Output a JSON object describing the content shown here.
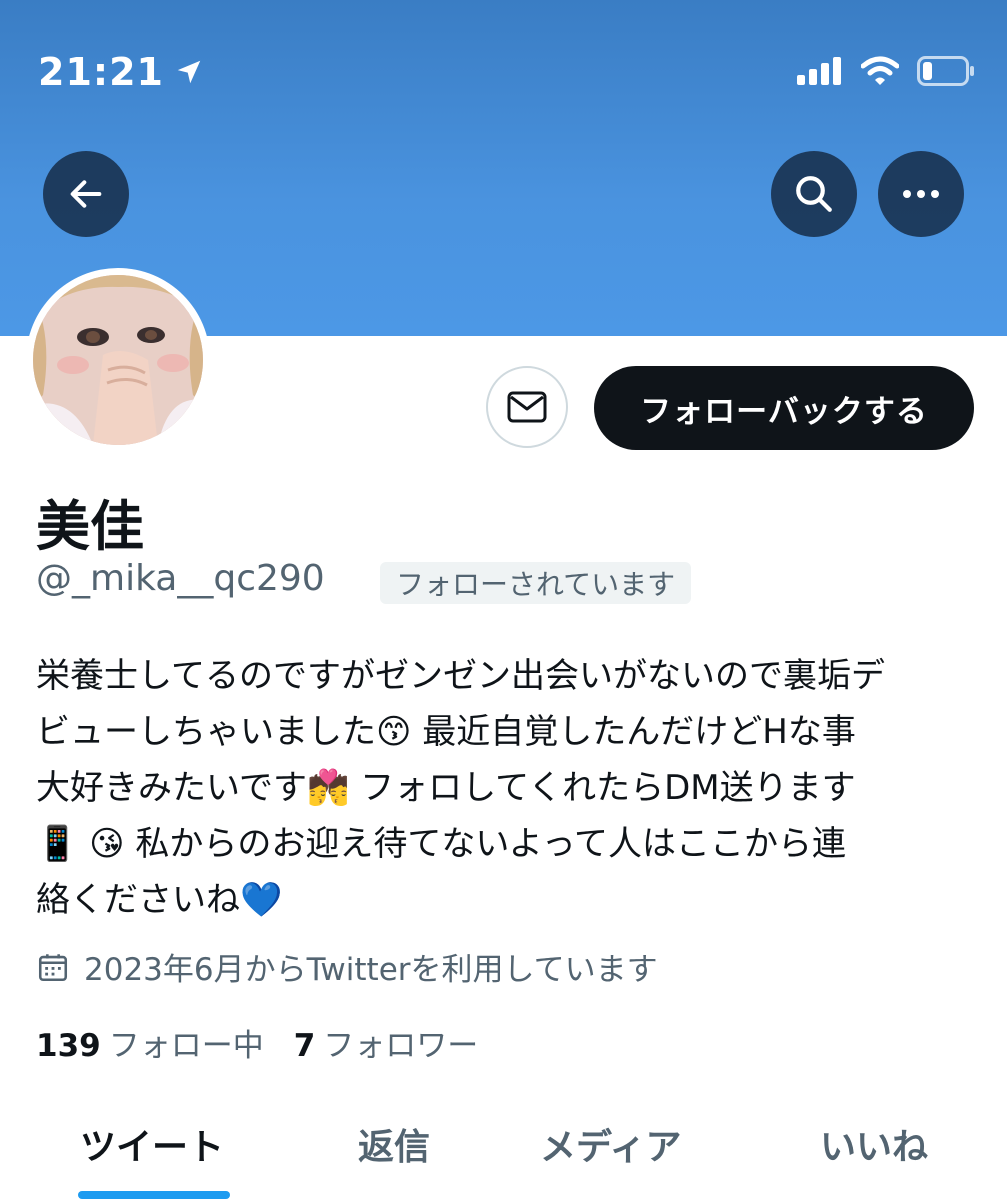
{
  "status_bar": {
    "time": "21:21"
  },
  "profile": {
    "name": "美佳",
    "handle": "@_mika__qc290",
    "follows_you": "フォローされています",
    "follow_back_label": "フォローバックする",
    "bio_lines": [
      "栄養士してるのですがゼンゼン出会いがないので裏垢デ",
      "ビューしちゃいました😙 最近自覚したんだけどHな事",
      "大好きみたいです💏 フォロしてくれたらDM送ります",
      "📱 😘 私からのお迎え待てないよって人はここから連",
      "絡くださいね💙"
    ],
    "joined": "2023年6月からTwitterを利用しています",
    "following_count": "139",
    "following_label": "フォロー中",
    "followers_count": "7",
    "followers_label": "フォロワー"
  },
  "tabs": [
    "ツイート",
    "返信",
    "メディア",
    "いいね"
  ],
  "colors": {
    "accent": "#1d9bf0",
    "header_top": "#3a7dc4",
    "header_bottom": "#4c98e6",
    "button_dark": "#0f1419"
  }
}
